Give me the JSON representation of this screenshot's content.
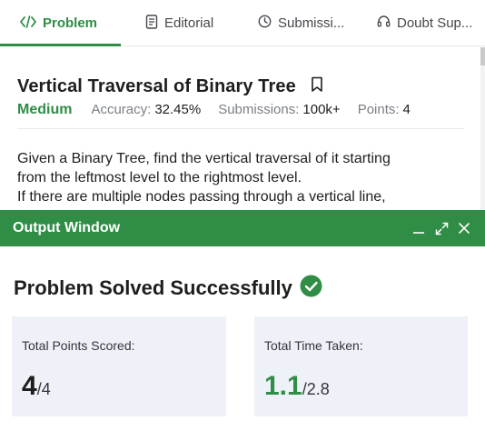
{
  "tabs": [
    {
      "label": "Problem",
      "icon": "code-icon"
    },
    {
      "label": "Editorial",
      "icon": "document-icon"
    },
    {
      "label": "Submissi...",
      "icon": "clock-icon"
    },
    {
      "label": "Doubt Sup...",
      "icon": "headset-icon"
    }
  ],
  "active_tab": "Problem",
  "problem": {
    "title": "Vertical Traversal of Binary Tree",
    "difficulty": "Medium",
    "accuracy_label": "Accuracy:",
    "accuracy_value": "32.45%",
    "submissions_label": "Submissions:",
    "submissions_value": "100k+",
    "points_label": "Points:",
    "points_value": "4",
    "description_lines": [
      "Given a Binary Tree, find the vertical traversal of it starting",
      "from the leftmost level to the rightmost level.",
      "If there are multiple nodes passing through a vertical line,"
    ]
  },
  "output_window": {
    "title": "Output Window",
    "status": "Problem Solved Successfully",
    "points_card": {
      "label": "Total Points Scored:",
      "value": "4",
      "total": "/4"
    },
    "time_card": {
      "label": "Total Time Taken:",
      "value": "1.1",
      "total": "/2.8"
    }
  },
  "colors": {
    "accent": "#2f8d46",
    "card_bg": "#eef1f8",
    "muted_text": "#7b7f85"
  }
}
